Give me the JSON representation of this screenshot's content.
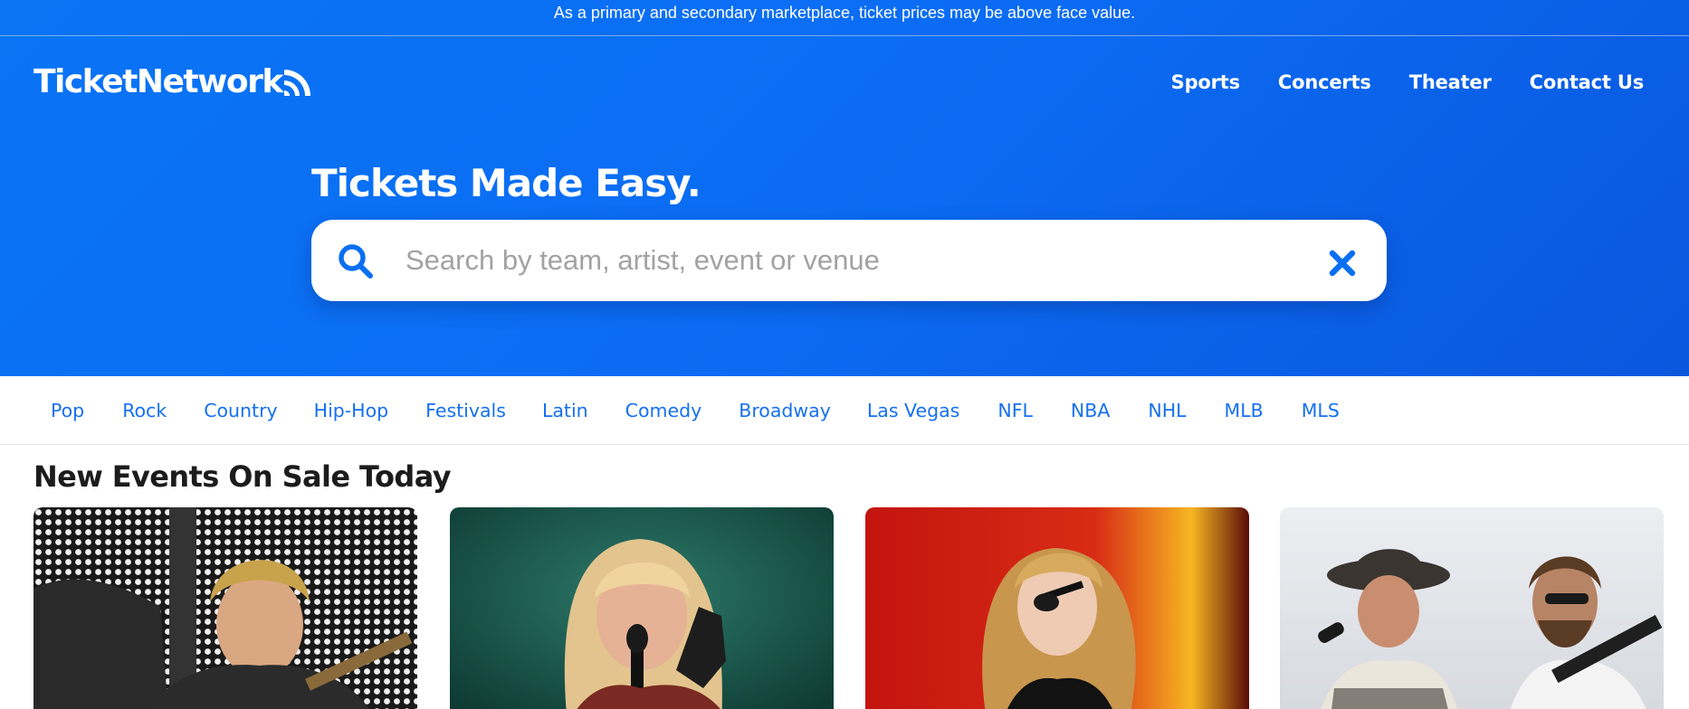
{
  "notice": "As a primary and secondary marketplace, ticket prices may be above face value.",
  "brand": {
    "name": "TicketNetwork",
    "logo_icon": "signal-waves-icon",
    "color": "#0a6ff2"
  },
  "nav": [
    {
      "label": "Sports"
    },
    {
      "label": "Concerts"
    },
    {
      "label": "Theater"
    },
    {
      "label": "Contact Us"
    }
  ],
  "hero": {
    "headline": "Tickets Made Easy.",
    "search": {
      "placeholder": "Search by team, artist, event or venue",
      "value": "",
      "search_icon": "magnifier-icon",
      "clear_icon": "close-x-icon"
    }
  },
  "categories": [
    {
      "label": "Pop"
    },
    {
      "label": "Rock"
    },
    {
      "label": "Country"
    },
    {
      "label": "Hip-Hop"
    },
    {
      "label": "Festivals"
    },
    {
      "label": "Latin"
    },
    {
      "label": "Comedy"
    },
    {
      "label": "Broadway"
    },
    {
      "label": "Las Vegas"
    },
    {
      "label": "NFL"
    },
    {
      "label": "NBA"
    },
    {
      "label": "NHL"
    },
    {
      "label": "MLB"
    },
    {
      "label": "MLS"
    }
  ],
  "section": {
    "title": "New Events On Sale Today"
  },
  "events": [
    {
      "image": "rock-singer-with-guitar-photo"
    },
    {
      "image": "blonde-singer-at-microphone-photo"
    },
    {
      "image": "singer-red-stage-photo"
    },
    {
      "image": "country-duo-cowboy-hat-photo"
    }
  ]
}
